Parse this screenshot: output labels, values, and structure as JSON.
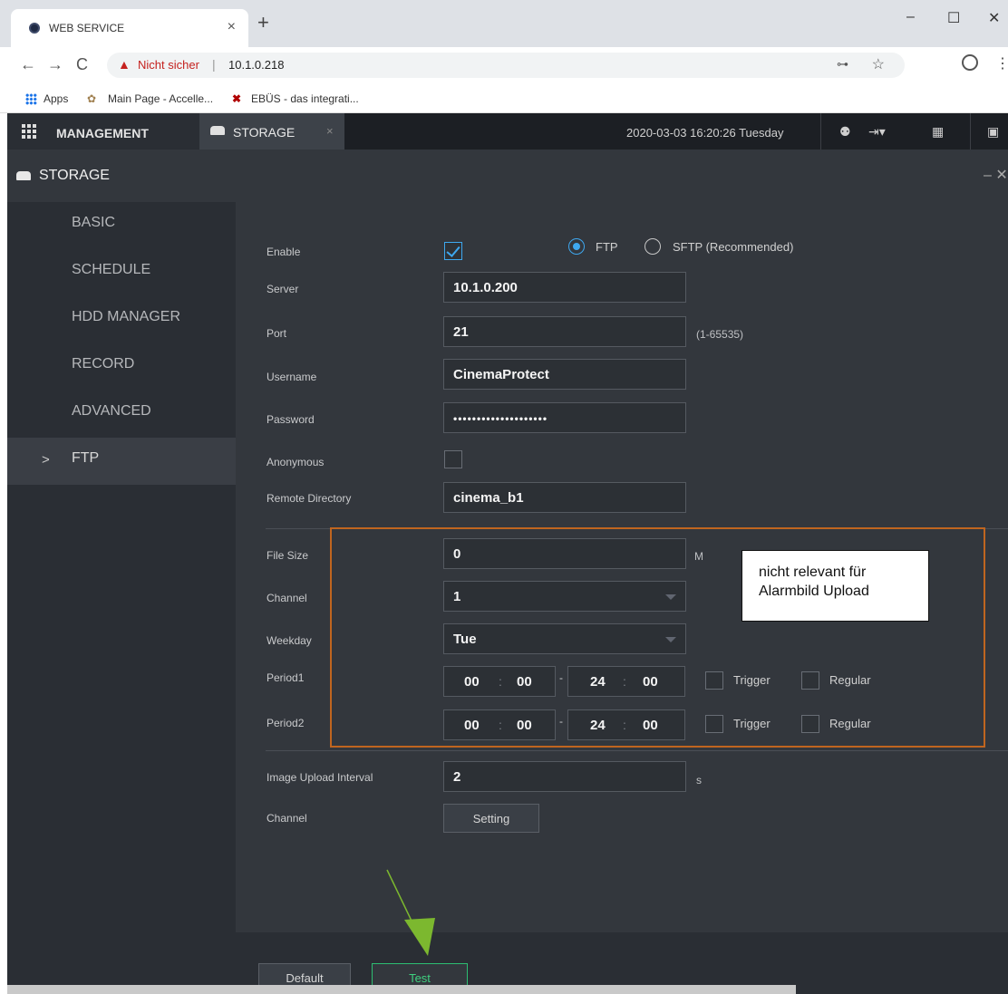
{
  "browser": {
    "tab_title": "WEB SERVICE",
    "tab_close": "×",
    "new_tab": "+",
    "win_minimize": "–",
    "win_maximize": "☐",
    "win_close": "✕",
    "security_warning": "Nicht sicher",
    "separator": "|",
    "url": "10.1.0.218",
    "bookmarks": [
      {
        "label": "Apps",
        "icon": "apps-grid-icon"
      },
      {
        "label": "Main Page - Accelle...",
        "icon": "wikimedia-icon"
      },
      {
        "label": "EBÜS - das integrati...",
        "icon": "ebus-icon"
      }
    ]
  },
  "app": {
    "management_label": "MANAGEMENT",
    "storage_tab_label": "STORAGE",
    "storage_tab_close": "×",
    "datetime": "2020-03-03 16:20:26 Tuesday",
    "panel_title": "STORAGE",
    "panel_controls": "– ✕"
  },
  "sidebar": {
    "items": [
      {
        "label": "BASIC",
        "active": false
      },
      {
        "label": "SCHEDULE",
        "active": false
      },
      {
        "label": "HDD MANAGER",
        "active": false
      },
      {
        "label": "RECORD",
        "active": false
      },
      {
        "label": "ADVANCED",
        "active": false
      },
      {
        "label": "FTP",
        "active": true
      }
    ],
    "active_marker": ">"
  },
  "form": {
    "enable": {
      "label": "Enable",
      "checked": true
    },
    "protocol": {
      "ftp_label": "FTP",
      "sftp_label": "SFTP (Recommended)",
      "selected": "FTP"
    },
    "server": {
      "label": "Server",
      "value": "10.1.0.200"
    },
    "port": {
      "label": "Port",
      "value": "21",
      "hint": "(1-65535)"
    },
    "username": {
      "label": "Username",
      "value": "CinemaProtect"
    },
    "password": {
      "label": "Password",
      "value": "••••••••••••••••••••"
    },
    "anonymous": {
      "label": "Anonymous",
      "checked": false
    },
    "remote_directory": {
      "label": "Remote Directory",
      "value": "cinema_b1"
    },
    "file_size": {
      "label": "File Size",
      "value": "0",
      "unit": "M"
    },
    "channel_select": {
      "label": "Channel",
      "value": "1"
    },
    "weekday": {
      "label": "Weekday",
      "value": "Tue"
    },
    "period1": {
      "label": "Period1",
      "start_h": "00",
      "start_m": "00",
      "end_h": "24",
      "end_m": "00",
      "trigger_label": "Trigger",
      "regular_label": "Regular"
    },
    "period2": {
      "label": "Period2",
      "start_h": "00",
      "start_m": "00",
      "end_h": "24",
      "end_m": "00",
      "trigger_label": "Trigger",
      "regular_label": "Regular"
    },
    "time_colon": ":",
    "range_dash": "-",
    "upload_interval": {
      "label": "Image Upload Interval",
      "value": "2",
      "unit": "s"
    },
    "channel_setting": {
      "label": "Channel",
      "button": "Setting"
    }
  },
  "footer": {
    "default_button": "Default",
    "test_button": "Test"
  },
  "annotation": {
    "callout_line1": "nicht relevant für",
    "callout_line2": "Alarmbild Upload",
    "box_color": "#c0651f",
    "arrow_color": "#7cb82f"
  }
}
